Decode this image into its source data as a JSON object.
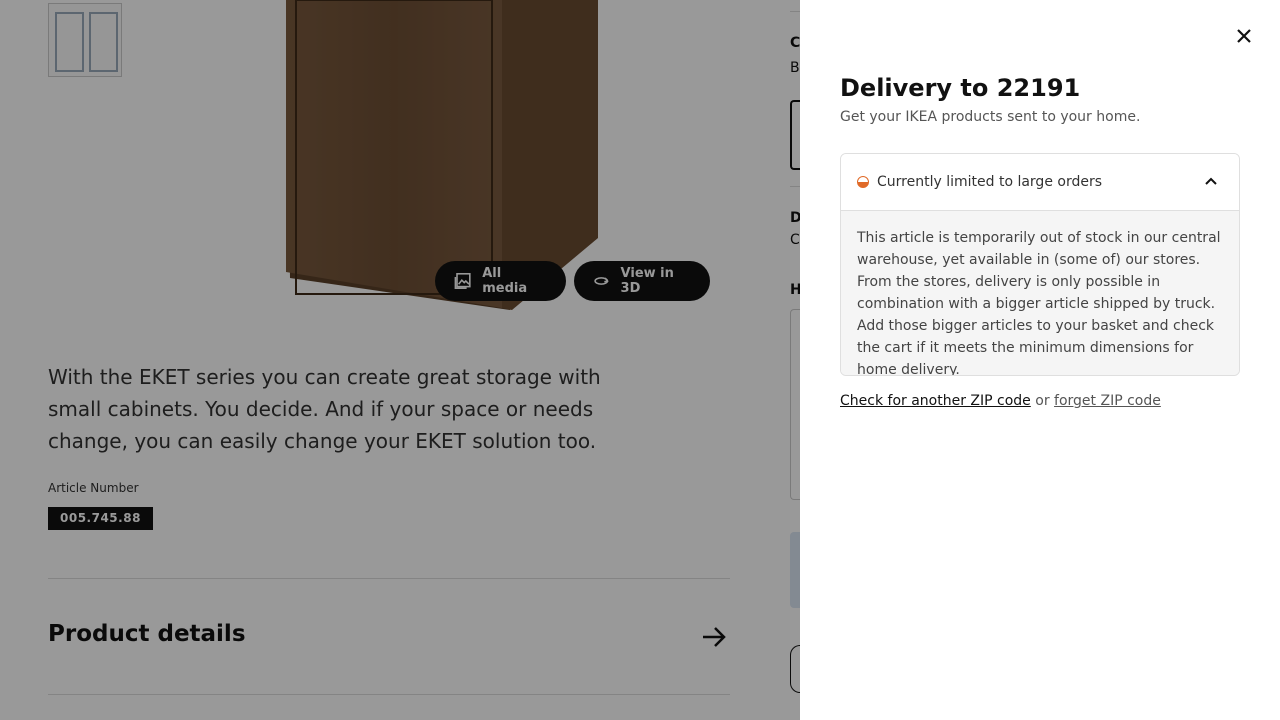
{
  "media": {
    "all_media_label": "All media",
    "view_3d_label": "View in 3D"
  },
  "product": {
    "description": "With the EKET series you can create great storage with small cabinets. You decide. And if your space or needs change, you can easily change your EKET solution too.",
    "article_label": "Article Number",
    "article_number": "005.745.88",
    "details_title": "Product details"
  },
  "right_column": {
    "cut_1": "C",
    "cut_2": "B",
    "cut_3": "D",
    "cut_4": "C",
    "cut_5": "H"
  },
  "drawer": {
    "title": "Delivery to 22191",
    "subtitle": "Get your IKEA products sent to your home.",
    "accordion": {
      "status_label": "Currently limited to large orders",
      "status_color": "#e06a28",
      "body": "This article is temporarily out of stock in our central warehouse, yet available in (some of) our stores. From the stores, delivery is only possible in combination with a bigger article shipped by truck. Add those bigger articles to your basket and check the cart if it meets the minimum dimensions for home delivery."
    },
    "zip_check_label": "Check for another ZIP code",
    "zip_or": "or",
    "zip_forget_label": "forget ZIP code"
  }
}
